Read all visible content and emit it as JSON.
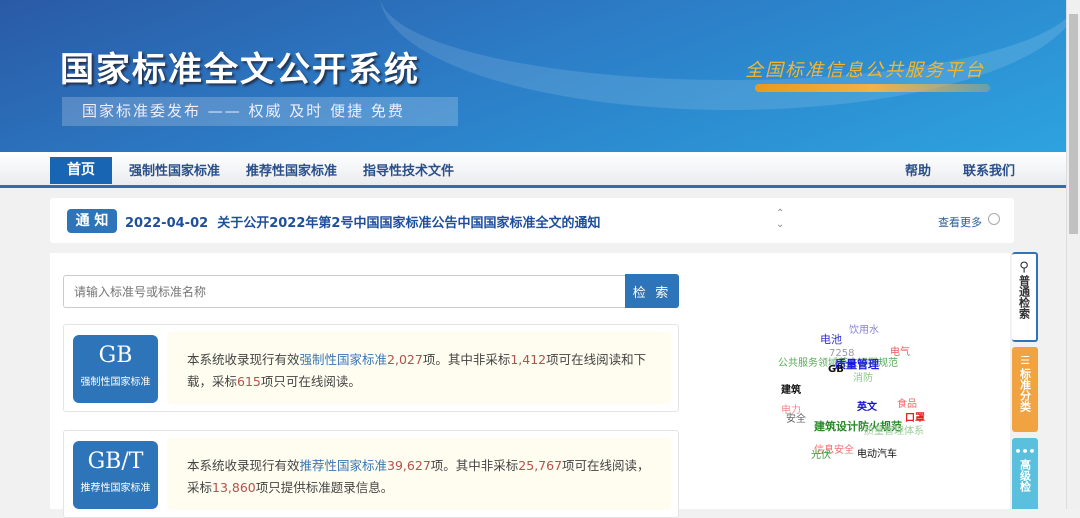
{
  "header": {
    "title": "国家标准全文公开系统",
    "slogan": "国家标准委发布 —— 权威 及时 便捷 免费",
    "platform": "全国标准信息公共服务平台"
  },
  "nav": {
    "items": [
      "首页",
      "强制性国家标准",
      "推荐性国家标准",
      "指导性技术文件"
    ],
    "help": "帮助",
    "contact": "联系我们"
  },
  "notice": {
    "badge": "通 知",
    "date": "2022-04-02",
    "text": "关于公开2022年第2号中国国家标准公告中国国家标准全文的通知",
    "more": "查看更多"
  },
  "search": {
    "placeholder": "请输入标准号或标准名称",
    "button": "检 索"
  },
  "cards": [
    {
      "code": "GB",
      "name": "强制性国家标准",
      "p1": "本系统收录现行有效",
      "type": "强制性国家标准",
      "total": "2,027",
      "p2": "项。其中非采标",
      "nonadopt": "1,412",
      "p3": "项可在线阅读和下载，采标",
      "adopt": "615",
      "p4": "项只可在线阅读。"
    },
    {
      "code": "GB/T",
      "name": "推荐性国家标准",
      "p1": "本系统收录现行有效",
      "type": "推荐性国家标准",
      "total": "39,627",
      "p2": "项。其中非采标",
      "nonadopt": "25,767",
      "p3": "项可在线阅读，采标",
      "adopt": "13,860",
      "p4": "项只提供标准题录信息。"
    }
  ],
  "word_cloud": [
    {
      "text": "饮用水",
      "color": "#8a7fe0"
    },
    {
      "text": "电池",
      "color": "#3030d0"
    },
    {
      "text": "电气",
      "color": "#e85a5a"
    },
    {
      "text": "公共服务领域英文译写规范",
      "color": "#5aaa5a"
    },
    {
      "text": "7258",
      "color": "#999999"
    },
    {
      "text": "质量管理",
      "color": "#1a1ae0"
    },
    {
      "text": "GB",
      "color": "#111111"
    },
    {
      "text": "消防",
      "color": "#8cc88c"
    },
    {
      "text": "建筑",
      "color": "#111111"
    },
    {
      "text": "食品",
      "color": "#ee6666"
    },
    {
      "text": "英文",
      "color": "#1010d0"
    },
    {
      "text": "电力",
      "color": "#f08a8a"
    },
    {
      "text": "口罩",
      "color": "#e02020"
    },
    {
      "text": "安全",
      "color": "#666666"
    },
    {
      "text": "建筑设计防火规范",
      "color": "#2a8a2a"
    },
    {
      "text": "质量管理体系",
      "color": "#99cc99"
    },
    {
      "text": "信息安全",
      "color": "#f07070"
    },
    {
      "text": "光伏",
      "color": "#3a9a3a"
    },
    {
      "text": "电动汽车",
      "color": "#111111"
    }
  ],
  "side_tabs": [
    {
      "label": "普通检索",
      "color": "#ffffff"
    },
    {
      "label": "标准分类",
      "color": "#f0a340"
    },
    {
      "label": "高级检",
      "color": "#5bc0de"
    }
  ]
}
